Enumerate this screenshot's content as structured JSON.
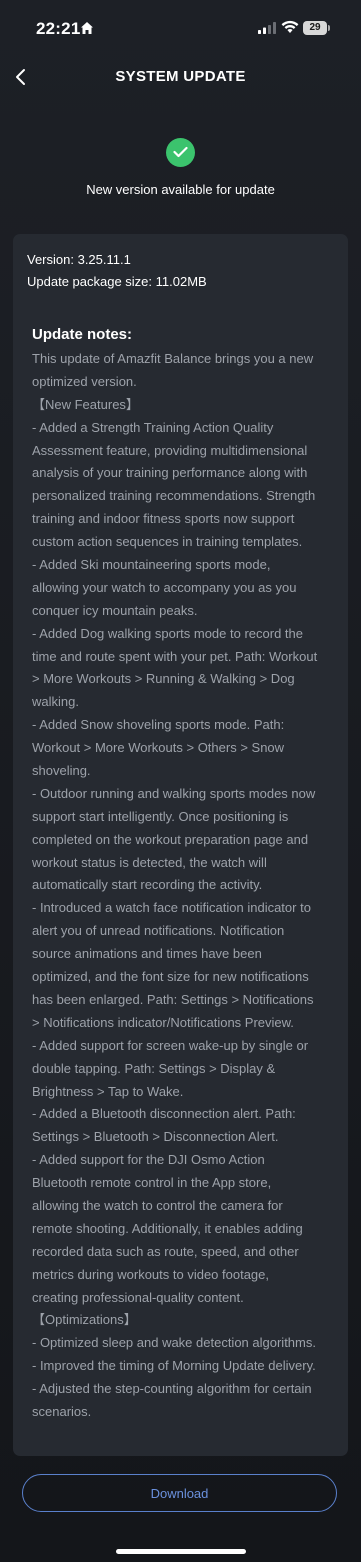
{
  "status_bar": {
    "time": "22:21",
    "battery": "29",
    "icons": [
      "home-icon",
      "signal-icon",
      "wifi-icon",
      "battery-icon"
    ]
  },
  "header": {
    "title": "SYSTEM UPDATE",
    "back_icon": "chevron-left-icon"
  },
  "status": {
    "icon": "check-circle-icon",
    "message": "New version available for update"
  },
  "info": {
    "version": "Version: 3.25.11.1",
    "package_size": "Update package size: 11.02MB"
  },
  "notes": {
    "title": "Update notes:",
    "lines": [
      "This update of Amazfit Balance brings you a new",
      "optimized version.",
      "【New Features】",
      "- Added a Strength Training Action Quality",
      "Assessment feature, providing multidimensional",
      "analysis of your training performance along with",
      "personalized training recommendations. Strength",
      "training and indoor fitness sports now support",
      "custom action sequences in training templates.",
      "- Added Ski mountaineering sports mode,",
      "allowing your watch to accompany you as you",
      "conquer icy mountain peaks.",
      "- Added Dog walking sports mode to record the",
      "time and route spent with your pet. Path: Workout",
      "> More Workouts > Running & Walking > Dog",
      "walking.",
      "- Added Snow shoveling sports mode. Path:",
      "Workout > More Workouts > Others > Snow",
      "shoveling.",
      "- Outdoor running and walking sports modes now",
      "support start intelligently. Once positioning is",
      "completed on the workout preparation page and",
      "workout status is detected, the watch will",
      "automatically start recording the activity.",
      "- Introduced a watch face notification indicator to",
      "alert you of unread notifications. Notification",
      "source animations and times have been",
      "optimized, and the font size for new notifications",
      "has been enlarged. Path: Settings > Notifications",
      "> Notifications indicator/Notifications Preview.",
      "- Added support for screen wake-up by single or",
      "double tapping. Path: Settings > Display &",
      "Brightness > Tap to Wake.",
      "- Added a Bluetooth disconnection alert. Path:",
      "Settings > Bluetooth > Disconnection Alert.",
      "- Added support for the DJI Osmo Action",
      "Bluetooth remote control in the App store,",
      "allowing the watch to control the camera for",
      "remote shooting. Additionally, it enables adding",
      "recorded data such as route, speed, and other",
      "metrics during workouts to video footage,",
      "creating professional-quality content.",
      "【Optimizations】",
      "- Optimized sleep and wake detection algorithms.",
      "- Improved the timing of Morning Update delivery.",
      "- Adjusted the step-counting algorithm for certain",
      "scenarios."
    ]
  },
  "actions": {
    "download_label": "Download"
  },
  "colors": {
    "background": "#1a1d22",
    "card": "#262a31",
    "accent": "#5a80cc",
    "success": "#3bc36d",
    "muted_text": "#9da2aa"
  }
}
